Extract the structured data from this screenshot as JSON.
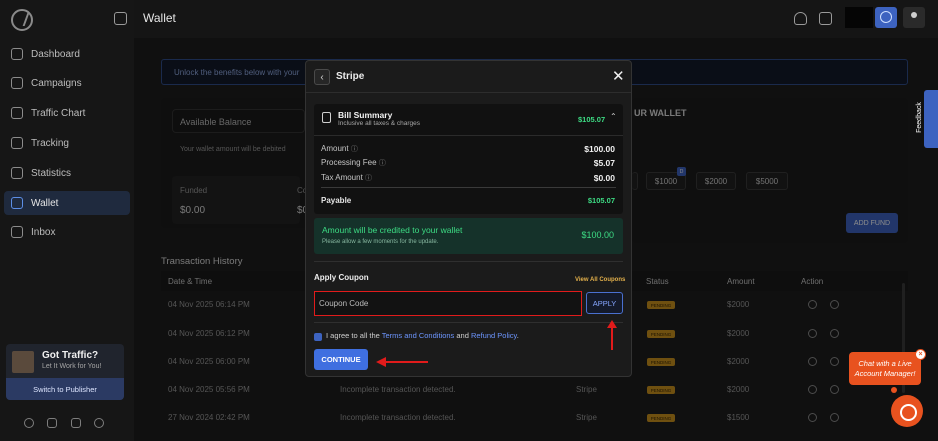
{
  "topbar": {
    "title": "Wallet"
  },
  "sidebar": {
    "items": [
      {
        "label": "Dashboard"
      },
      {
        "label": "Campaigns"
      },
      {
        "label": "Traffic Chart"
      },
      {
        "label": "Tracking"
      },
      {
        "label": "Statistics"
      },
      {
        "label": "Wallet"
      },
      {
        "label": "Inbox"
      }
    ],
    "promo": {
      "title": "Got Traffic?",
      "subtitle": "Let It Work for You!",
      "button": "Switch to Publisher"
    }
  },
  "background": {
    "banner": "Unlock the benefits below with your",
    "available_balance": "Available Balance",
    "debit_note": "Your wallet amount will be debited",
    "funded_label": "Funded",
    "funded_value": "$0.00",
    "second_label": "Co",
    "second_value": "$0",
    "wallet_title": "UR WALLET",
    "amounts": [
      "$1000",
      "$2000",
      "$5000"
    ],
    "amount_badge": "D",
    "add_fund": "ADD FUND",
    "history_title": "Transaction History",
    "columns": [
      "Date & Time",
      "Status",
      "Amount",
      "Action"
    ],
    "rows": [
      {
        "date": "04 Nov 2025 06:14 PM",
        "desc": "",
        "method": "",
        "status": "PENDING",
        "amount": "$2000"
      },
      {
        "date": "04 Nov 2025 06:12 PM",
        "desc": "",
        "method": "",
        "status": "PENDING",
        "amount": "$2000"
      },
      {
        "date": "04 Nov 2025 06:00 PM",
        "desc": "",
        "method": "",
        "status": "PENDING",
        "amount": "$2000"
      },
      {
        "date": "04 Nov 2025 05:56 PM",
        "desc": "Incomplete transaction detected.",
        "method": "Stripe",
        "status": "PENDING",
        "amount": "$2000"
      },
      {
        "date": "27 Nov 2024 02:42 PM",
        "desc": "Incomplete transaction detected.",
        "method": "Stripe",
        "status": "PENDING",
        "amount": "$1500"
      }
    ],
    "feedback": "Feedback"
  },
  "modal": {
    "title": "Stripe",
    "bill": {
      "title": "Bill Summary",
      "subtitle": "Inclusive all taxes & charges",
      "total": "$105.07",
      "lines": [
        {
          "label": "Amount",
          "value": "$100.00"
        },
        {
          "label": "Processing Fee",
          "value": "$5.07"
        },
        {
          "label": "Tax Amount",
          "value": "$0.00"
        }
      ],
      "payable_label": "Payable",
      "payable_value": "$105.07"
    },
    "credit": {
      "title": "Amount will be credited to your wallet",
      "subtitle": "Please allow a few moments for the update.",
      "value": "$100.00"
    },
    "coupon": {
      "label": "Apply Coupon",
      "view_all": "View All Coupons",
      "placeholder": "Coupon Code",
      "apply": "APPLY"
    },
    "agree": {
      "prefix": "I agree to all the",
      "terms": "Terms and Conditions",
      "and": "and",
      "refund": "Refund Policy",
      "suffix": "."
    },
    "continue": "CONTINUE"
  },
  "chat": {
    "bubble": "Chat with a Live Account Manager!"
  },
  "colors": {
    "accent": "#3f6fe0",
    "success": "#3ddc84",
    "highlight": "#e11b1b",
    "chat": "#e8521f"
  }
}
